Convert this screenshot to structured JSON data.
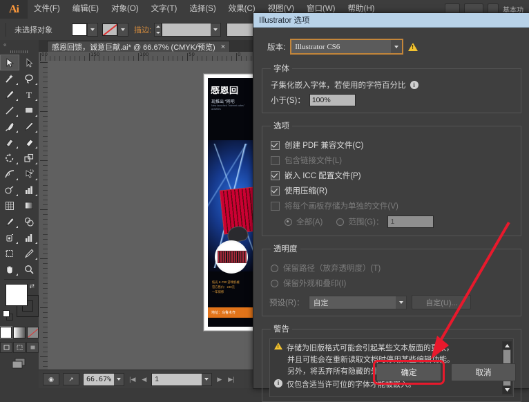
{
  "menubar": {
    "logo": "Ai",
    "items": [
      "文件(F)",
      "编辑(E)",
      "对象(O)",
      "文字(T)",
      "选择(S)",
      "效果(C)",
      "视图(V)",
      "窗口(W)",
      "帮助(H)"
    ],
    "workspace_label": "基本功"
  },
  "controlbar": {
    "selection_label": "未选择对象",
    "stroke_label": "描边:",
    "stroke_weight": ""
  },
  "document": {
    "tab_title": "感恩回馈，诚意巨献.ai* @ 66.67% (CMYK/预览)",
    "close_glyph": "×"
  },
  "ruler": {
    "h_labels": [
      "00",
      "150",
      "100",
      "50",
      "0",
      "50"
    ]
  },
  "artwork": {
    "headline": "感恩回",
    "subhead": "现推出 “网吧",
    "english": "New launched \"Internet cafes\" activities",
    "price_line1": "炫光 K-780 游戏机械",
    "price_line2": "官方售价：240元",
    "price_line3": "一年保修",
    "footer": "地址：乌鲁木齐"
  },
  "statusbar": {
    "zoom": "66.67%",
    "page": "1"
  },
  "dialog": {
    "title": "Illustrator 选项",
    "version": {
      "label": "版本:",
      "value": "Illustrator CS6"
    },
    "fonts": {
      "legend": "字体",
      "description": "子集化嵌入字体，若使用的字符百分比",
      "less_than_label": "小于(S)：",
      "less_than_value": "100%"
    },
    "options": {
      "legend": "选项",
      "items": [
        {
          "label": "创建 PDF 兼容文件(C)",
          "checked": true,
          "disabled": false
        },
        {
          "label": "包含链接文件(L)",
          "checked": false,
          "disabled": true
        },
        {
          "label": "嵌入 ICC 配置文件(P)",
          "checked": true,
          "disabled": false
        },
        {
          "label": "使用压缩(R)",
          "checked": true,
          "disabled": false
        },
        {
          "label": "将每个画板存储为单独的文件(V)",
          "checked": false,
          "disabled": true
        }
      ],
      "radio_all": "全部(A)",
      "radio_range": "范围(G)：",
      "range_value": "1"
    },
    "transparency": {
      "legend": "透明度",
      "radio_preserve_path": "保留路径（放弃透明度）(T)",
      "radio_preserve_look": "保留外观和叠印(I)",
      "preset_label": "预设(R)：",
      "preset_value": "自定",
      "custom_button": "自定(U)..."
    },
    "warnings": {
      "legend": "警告",
      "line1": "存储为旧版格式可能会引起某些文本版面的更改，",
      "line2": "并且可能会在重新读取文档时停用某些编辑功能。",
      "line3": "另外，将丢弃所有隐藏的外观属性。",
      "line4": "仅包含适当许可位的字体才能被嵌入。"
    },
    "buttons": {
      "ok": "确定",
      "cancel": "取消"
    }
  },
  "colors": {
    "accent_orange": "#c4863a",
    "warning_yellow": "#f2c230",
    "annotation_red": "#e8192c",
    "titlebar_blue": "#b8d2e8"
  }
}
